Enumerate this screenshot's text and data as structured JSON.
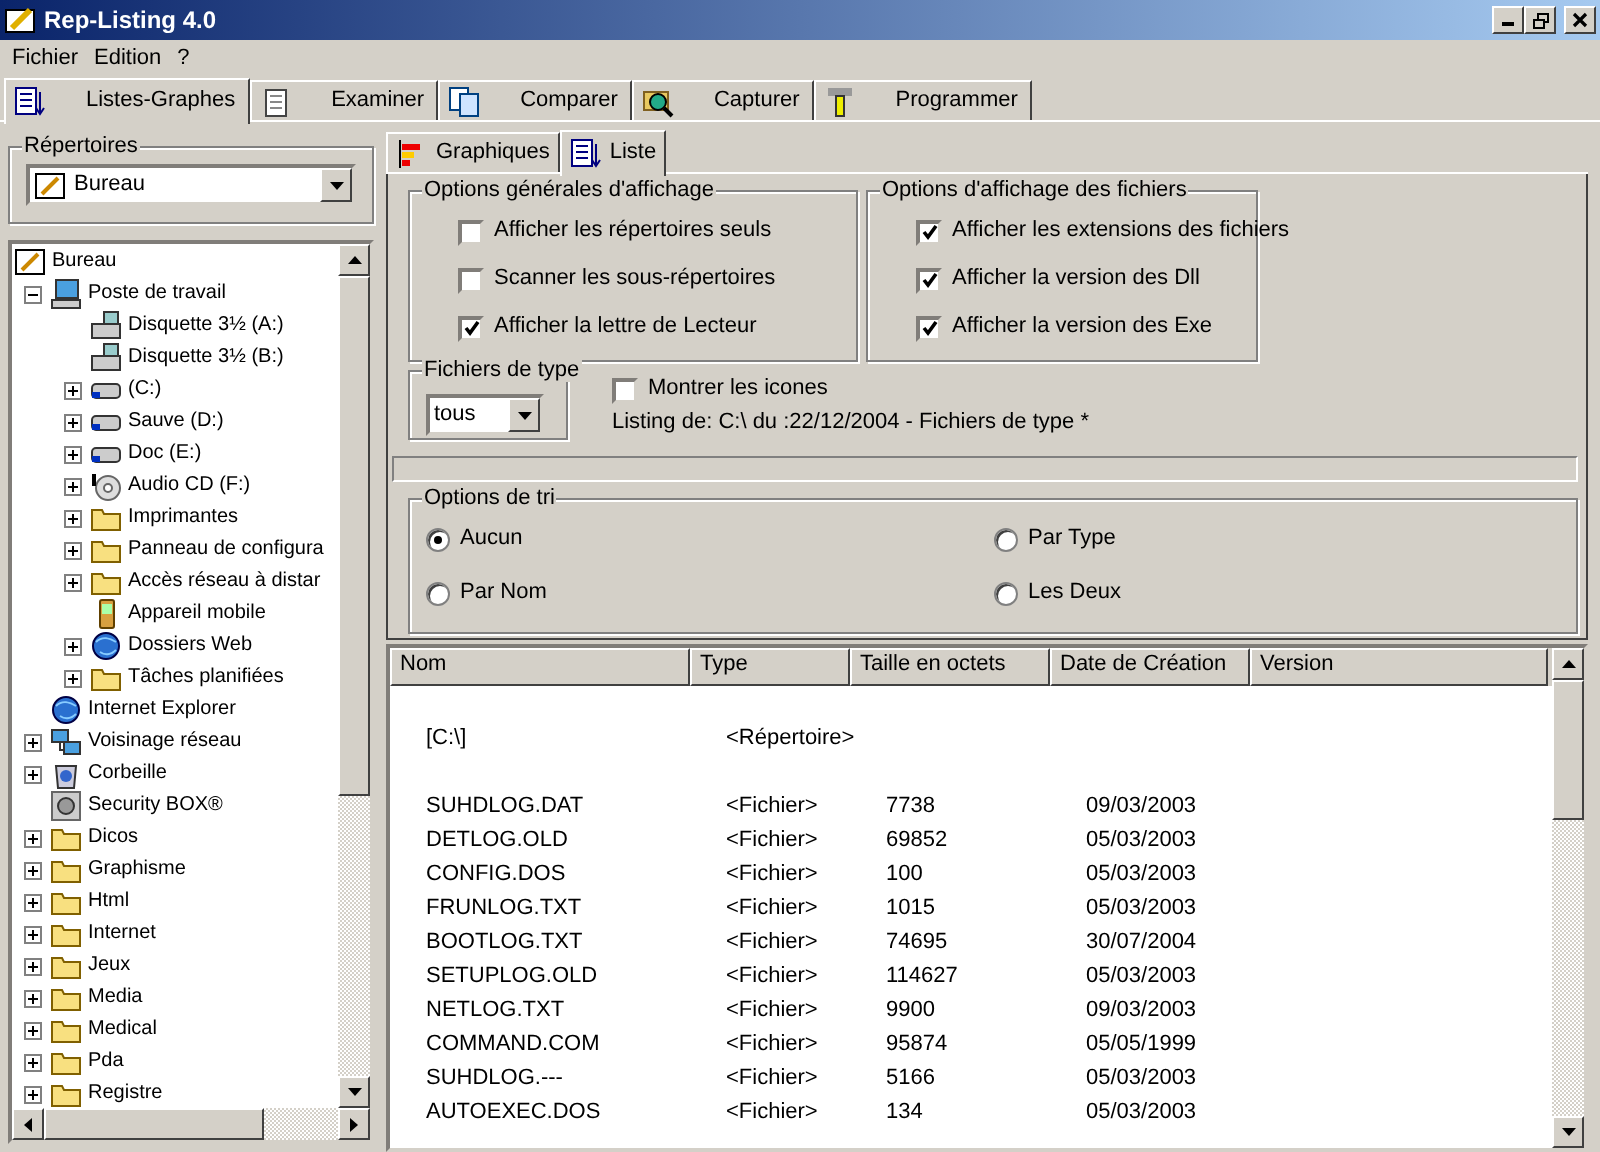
{
  "window": {
    "title": "Rep-Listing 4.0"
  },
  "menu": [
    "Fichier",
    "Edition",
    "?"
  ],
  "tabs": [
    {
      "label": "Listes-Graphes",
      "kind": "list",
      "selected": true
    },
    {
      "label": "Examiner",
      "kind": "notepad",
      "selected": false
    },
    {
      "label": "Comparer",
      "kind": "copy",
      "selected": false
    },
    {
      "label": "Capturer",
      "kind": "magnifier",
      "selected": false
    },
    {
      "label": "Programmer",
      "kind": "tool",
      "selected": false
    }
  ],
  "directories": {
    "title": "Répertoires",
    "value": "Bureau"
  },
  "tree": [
    {
      "label": "Bureau",
      "kind": "desktop",
      "children": [
        {
          "label": "Poste de travail",
          "kind": "computer",
          "expanded": true,
          "children": [
            {
              "label": "Disquette 3½ (A:)",
              "kind": "floppy"
            },
            {
              "label": "Disquette 3½ (B:)",
              "kind": "floppy"
            },
            {
              "label": " (C:)",
              "kind": "drive",
              "expanded": false
            },
            {
              "label": "Sauve (D:)",
              "kind": "drive",
              "expanded": false
            },
            {
              "label": "Doc (E:)",
              "kind": "drive",
              "expanded": false
            },
            {
              "label": "Audio CD (F:)",
              "kind": "cd",
              "expanded": false
            },
            {
              "label": "Imprimantes",
              "kind": "folder",
              "expanded": false
            },
            {
              "label": "Panneau de configura",
              "kind": "folder",
              "expanded": false
            },
            {
              "label": "Accès réseau à distar",
              "kind": "folder",
              "expanded": false
            },
            {
              "label": "Appareil mobile",
              "kind": "mobile"
            },
            {
              "label": "Dossiers Web",
              "kind": "globe",
              "expanded": false
            },
            {
              "label": "Tâches planifiées",
              "kind": "folder",
              "expanded": false
            }
          ]
        },
        {
          "label": "Internet Explorer",
          "kind": "globe"
        },
        {
          "label": "Voisinage réseau",
          "kind": "network",
          "expanded": false
        },
        {
          "label": "Corbeille",
          "kind": "bin",
          "expanded": false
        },
        {
          "label": "Security BOX®",
          "kind": "safe"
        },
        {
          "label": "Dicos",
          "kind": "folder",
          "expanded": false
        },
        {
          "label": "Graphisme",
          "kind": "folder",
          "expanded": false
        },
        {
          "label": "Html",
          "kind": "folder",
          "expanded": false
        },
        {
          "label": "Internet",
          "kind": "folder",
          "expanded": false
        },
        {
          "label": "Jeux",
          "kind": "folder",
          "expanded": false
        },
        {
          "label": "Media",
          "kind": "folder",
          "expanded": false
        },
        {
          "label": "Medical",
          "kind": "folder",
          "expanded": false
        },
        {
          "label": "Pda",
          "kind": "folder",
          "expanded": false
        },
        {
          "label": "Registre",
          "kind": "folder",
          "expanded": false
        }
      ]
    }
  ],
  "subtabs": [
    {
      "label": "Graphiques",
      "kind": "chart",
      "selected": false
    },
    {
      "label": "Liste",
      "kind": "list",
      "selected": true
    }
  ],
  "general_options": {
    "title": "Options générales d'affichage",
    "items": [
      {
        "label": "Afficher les répertoires seuls",
        "checked": false
      },
      {
        "label": "Scanner les sous-répertoires",
        "checked": false
      },
      {
        "label": "Afficher la lettre de Lecteur",
        "checked": true
      }
    ]
  },
  "file_options": {
    "title": "Options d'affichage des fichiers",
    "items": [
      {
        "label": "Afficher les extensions des fichiers",
        "checked": true
      },
      {
        "label": "Afficher la version des Dll",
        "checked": true
      },
      {
        "label": "Afficher la version des Exe",
        "checked": true
      }
    ]
  },
  "file_type": {
    "title": "Fichiers de type",
    "value": "tous"
  },
  "show_icons": {
    "label": "Montrer les icones",
    "checked": false
  },
  "listing_info": "Listing de: C:\\ du :22/12/2004 - Fichiers de type *",
  "sort_options": {
    "title": "Options de tri",
    "items": [
      {
        "label": "Aucun",
        "selected": true
      },
      {
        "label": "Par Type",
        "selected": false
      },
      {
        "label": "Par Nom",
        "selected": false
      },
      {
        "label": "Les Deux",
        "selected": false
      }
    ]
  },
  "table": {
    "columns": [
      "Nom",
      "Type",
      "Taille en octets",
      "Date de Création",
      "Version"
    ],
    "rows": [
      {
        "kind": "directory",
        "cells": [
          "[C:\\]",
          "<Répertoire>",
          "",
          ""
        ]
      },
      {
        "kind": "file",
        "cells": [
          "SUHDLOG.DAT",
          "<Fichier>",
          "7738",
          "09/03/2003"
        ]
      },
      {
        "kind": "file",
        "cells": [
          "DETLOG.OLD",
          "<Fichier>",
          "69852",
          "05/03/2003"
        ]
      },
      {
        "kind": "file",
        "cells": [
          "CONFIG.DOS",
          "<Fichier>",
          "100",
          "05/03/2003"
        ]
      },
      {
        "kind": "file",
        "cells": [
          "FRUNLOG.TXT",
          "<Fichier>",
          "1015",
          "05/03/2003"
        ]
      },
      {
        "kind": "file",
        "cells": [
          "BOOTLOG.TXT",
          "<Fichier>",
          "74695",
          "30/07/2004"
        ]
      },
      {
        "kind": "file",
        "cells": [
          "SETUPLOG.OLD",
          "<Fichier>",
          "114627",
          "05/03/2003"
        ]
      },
      {
        "kind": "file",
        "cells": [
          "NETLOG.TXT",
          "<Fichier>",
          "9900",
          "09/03/2003"
        ]
      },
      {
        "kind": "file",
        "cells": [
          "COMMAND.COM",
          "<Fichier>",
          "95874",
          "05/05/1999"
        ]
      },
      {
        "kind": "file",
        "cells": [
          "SUHDLOG.---",
          "<Fichier>",
          "5166",
          "05/03/2003"
        ]
      },
      {
        "kind": "file",
        "cells": [
          "AUTOEXEC.DOS",
          "<Fichier>",
          "134",
          "05/03/2003"
        ]
      }
    ]
  }
}
